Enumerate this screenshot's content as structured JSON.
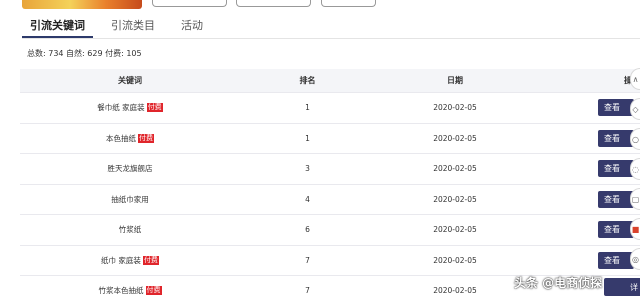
{
  "tabs": [
    {
      "label": "引流关键词",
      "active": true
    },
    {
      "label": "引流类目",
      "active": false
    },
    {
      "label": "活动",
      "active": false
    }
  ],
  "stats": "总数: 734 自然: 629 付费: 105",
  "table": {
    "headers": {
      "keyword": "关键词",
      "rank": "排名",
      "date": "日期",
      "action": "操作"
    },
    "rows": [
      {
        "keyword": "餐巾纸 家庭装",
        "paid_tag": "付费",
        "rank": "1",
        "date": "2020-02-05",
        "action": "查看"
      },
      {
        "keyword": "本色抽纸",
        "paid_tag": "付费",
        "rank": "1",
        "date": "2020-02-05",
        "action": "查看"
      },
      {
        "keyword": "胜天龙旗舰店",
        "paid_tag": "",
        "rank": "3",
        "date": "2020-02-05",
        "action": "查看"
      },
      {
        "keyword": "抽纸巾家用",
        "paid_tag": "",
        "rank": "4",
        "date": "2020-02-05",
        "action": "查看"
      },
      {
        "keyword": "竹浆纸",
        "paid_tag": "",
        "rank": "6",
        "date": "2020-02-05",
        "action": "查看"
      },
      {
        "keyword": "纸巾 家庭装",
        "paid_tag": "付费",
        "rank": "7",
        "date": "2020-02-05",
        "action": "查看"
      },
      {
        "keyword": "竹浆本色抽纸",
        "paid_tag": "付费",
        "rank": "7",
        "date": "2020-02-05",
        "action": "详"
      }
    ]
  },
  "watermark": "头条 @电商侦探",
  "colors": {
    "button": "#363a6c",
    "paid_tag": "#e0252b",
    "header_bg": "#f4f5f8"
  }
}
